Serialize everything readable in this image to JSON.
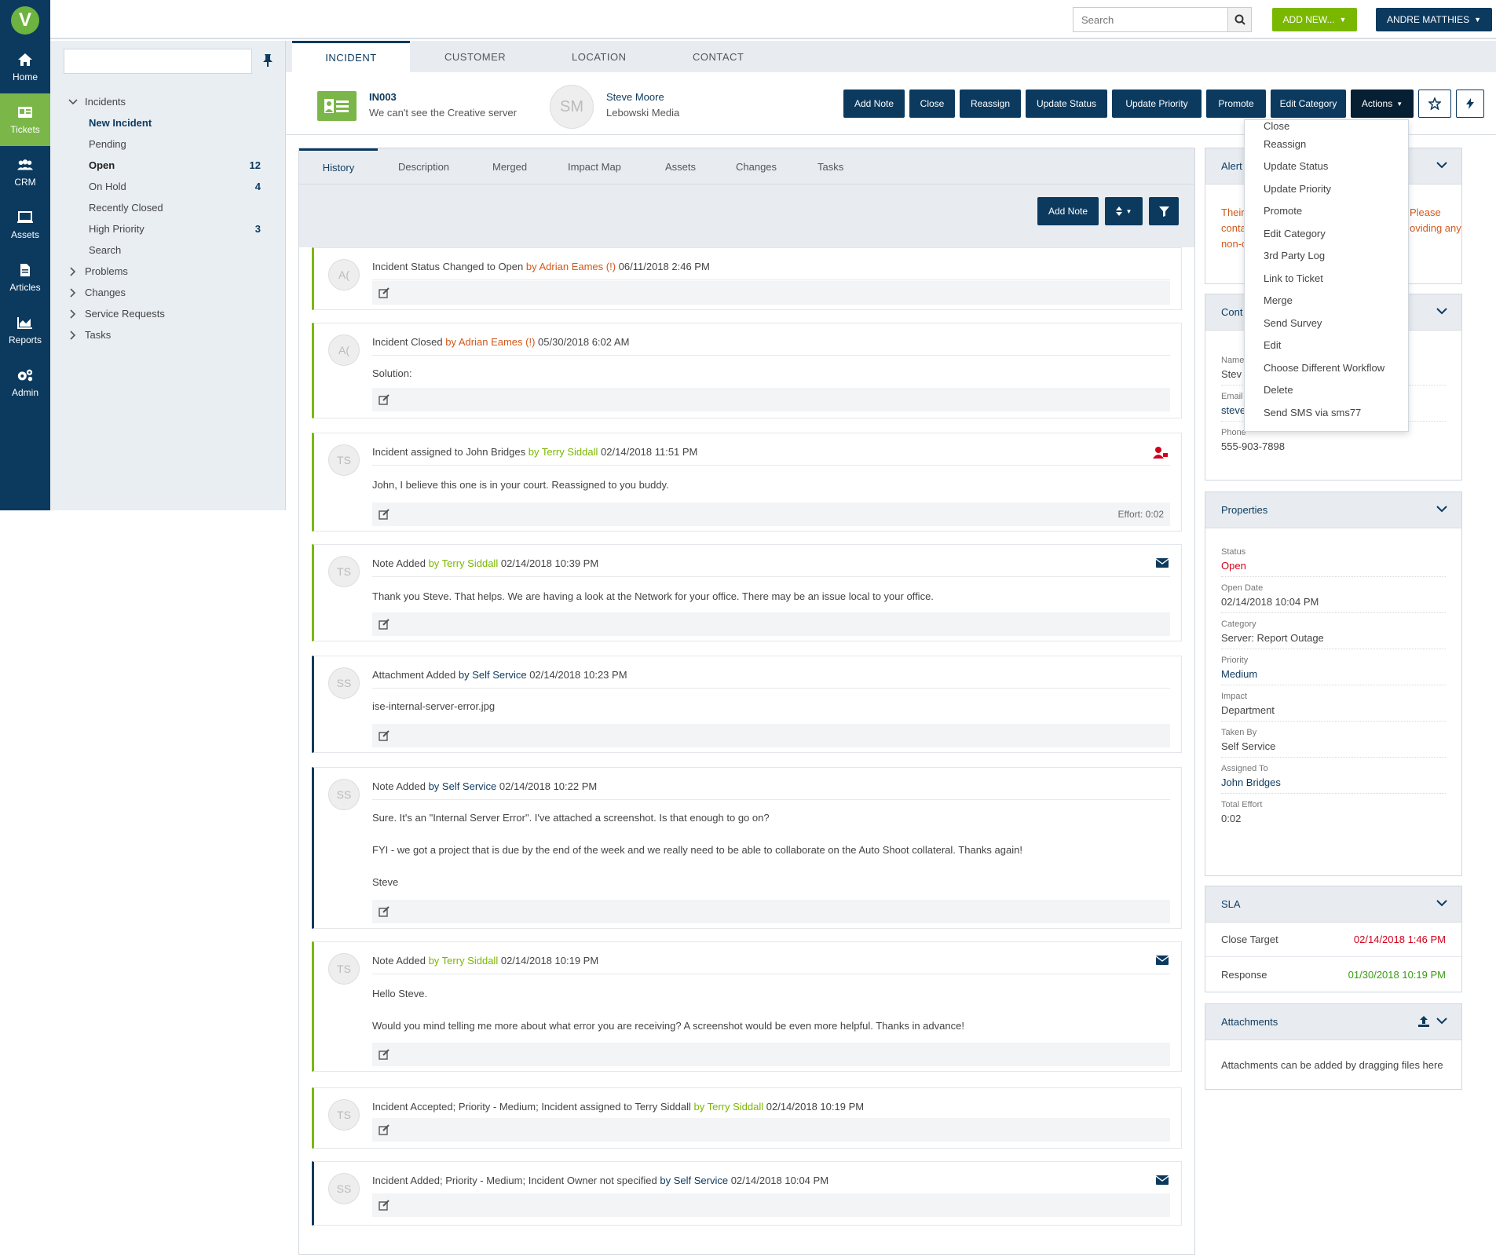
{
  "nav": {
    "logo": "V",
    "items": [
      {
        "label": "Home",
        "icon": "home-icon"
      },
      {
        "label": "Tickets",
        "icon": "tickets-icon"
      },
      {
        "label": "CRM",
        "icon": "crm-icon"
      },
      {
        "label": "Assets",
        "icon": "assets-icon"
      },
      {
        "label": "Articles",
        "icon": "articles-icon"
      },
      {
        "label": "Reports",
        "icon": "reports-icon"
      },
      {
        "label": "Admin",
        "icon": "admin-icon"
      }
    ]
  },
  "topbar": {
    "search_placeholder": "Search",
    "add_new": "ADD NEW...",
    "user": "ANDRE MATTHIES"
  },
  "sidebar": {
    "incidents": "Incidents",
    "items": [
      {
        "label": "New Incident",
        "count": ""
      },
      {
        "label": "Pending",
        "count": ""
      },
      {
        "label": "Open",
        "count": "12"
      },
      {
        "label": "On Hold",
        "count": "4"
      },
      {
        "label": "Recently Closed",
        "count": ""
      },
      {
        "label": "High Priority",
        "count": "3"
      },
      {
        "label": "Search",
        "count": ""
      }
    ],
    "groups": [
      "Problems",
      "Changes",
      "Service Requests",
      "Tasks"
    ]
  },
  "object_tabs": [
    "INCIDENT",
    "CUSTOMER",
    "LOCATION",
    "CONTACT"
  ],
  "ticket": {
    "number": "IN003",
    "subject": "We can't see the Creative server",
    "customer_initials": "SM",
    "customer_name": "Steve Moore",
    "customer_org": "Lebowski Media"
  },
  "header_buttons": {
    "add_note": "Add Note",
    "close": "Close",
    "reassign": "Reassign",
    "update_status": "Update Status",
    "update_priority": "Update Priority",
    "promote": "Promote",
    "edit_category": "Edit Category",
    "actions": "Actions"
  },
  "sub_tabs": [
    "History",
    "Description",
    "Merged",
    "Impact Map",
    "Assets",
    "Changes",
    "Tasks"
  ],
  "history_toolbar": {
    "add_note": "Add Note"
  },
  "entries": [
    {
      "initials": "A(",
      "text": "Incident Status Changed to Open",
      "by": "by Adrian Eames (!)",
      "date": "06/11/2018 2:46 PM"
    },
    {
      "initials": "A(",
      "text": "Incident Closed",
      "by": "by Adrian Eames (!)",
      "date": "05/30/2018 6:02 AM",
      "body": [
        "Solution:"
      ]
    },
    {
      "initials": "TS",
      "text": "Incident assigned to John Bridges",
      "by": "by Terry Siddall",
      "date": "02/14/2018 11:51 PM",
      "body": [
        "John, I believe this one is in your court. Reassigned to you buddy."
      ],
      "effort": "Effort: 0:02"
    },
    {
      "initials": "TS",
      "text": "Note Added",
      "by": "by Terry Siddall",
      "date": "02/14/2018 10:39 PM",
      "body": [
        "Thank you Steve. That helps. We are having a look at the Network for your office. There may be an issue local to your office."
      ]
    },
    {
      "initials": "SS",
      "text": "Attachment Added",
      "by": "by Self Service",
      "date": "02/14/2018 10:23 PM",
      "body": [
        "ise-internal-server-error.jpg"
      ]
    },
    {
      "initials": "SS",
      "text": "Note Added",
      "by": "by Self Service",
      "date": "02/14/2018 10:22 PM",
      "body": [
        "Sure. It's an \"Internal Server Error\". I've attached a screenshot. Is that enough to go on?",
        "FYI - we got a project that is due by the end of the week and we really need to be able to collaborate on the Auto Shoot collateral. Thanks again!",
        "Steve"
      ]
    },
    {
      "initials": "TS",
      "text": "Note Added",
      "by": "by Terry Siddall",
      "date": "02/14/2018 10:19 PM",
      "body": [
        "Hello Steve.",
        "Would you mind telling me more about what error you are receiving? A screenshot would be even more helpful. Thanks in advance!"
      ]
    },
    {
      "initials": "TS",
      "text": "Incident Accepted; Priority - Medium; Incident assigned to Terry Siddall",
      "by": "by Terry Siddall",
      "date": "02/14/2018 10:19 PM"
    },
    {
      "initials": "SS",
      "text": "Incident Added; Priority - Medium; Incident Owner not specified",
      "by": "by Self Service",
      "date": "02/14/2018 10:04 PM"
    }
  ],
  "alert": {
    "title": "Alert",
    "text_left": [
      "Their",
      "conta",
      "non-c"
    ],
    "text_right": [
      "Please",
      "oviding any"
    ]
  },
  "contact": {
    "title": "Cont",
    "name_label": "Name",
    "name_value": "Stev",
    "email_label": "Email",
    "email_value": "steve",
    "phone_label": "Phone",
    "phone_value": "555-903-7898"
  },
  "properties": {
    "title": "Properties",
    "items": [
      {
        "label": "Status",
        "value": "Open"
      },
      {
        "label": "Open Date",
        "value": "02/14/2018 10:04 PM"
      },
      {
        "label": "Category",
        "value": "Server: Report Outage"
      },
      {
        "label": "Priority",
        "value": "Medium"
      },
      {
        "label": "Impact",
        "value": "Department"
      },
      {
        "label": "Taken By",
        "value": "Self Service"
      },
      {
        "label": "Assigned To",
        "value": "John Bridges"
      },
      {
        "label": "Total Effort",
        "value": "0:02"
      }
    ]
  },
  "sla": {
    "title": "SLA",
    "close_target_label": "Close Target",
    "close_target_value": "02/14/2018 1:46 PM",
    "response_label": "Response",
    "response_value": "01/30/2018 10:19 PM"
  },
  "attachments": {
    "title": "Attachments",
    "hint": "Attachments can be added by dragging files here"
  },
  "actions_menu": [
    "Close",
    "Reassign",
    "Update Status",
    "Update Priority",
    "Promote",
    "Edit Category",
    "3rd Party Log",
    "Link to Ticket",
    "Merge",
    "Send Survey",
    "Edit",
    "Choose Different Workflow",
    "Delete",
    "Send SMS via sms77"
  ],
  "colors": {
    "navy": "#0c3a5f",
    "green": "#7ab800",
    "orange": "#d2581b",
    "red": "#d0021b"
  }
}
